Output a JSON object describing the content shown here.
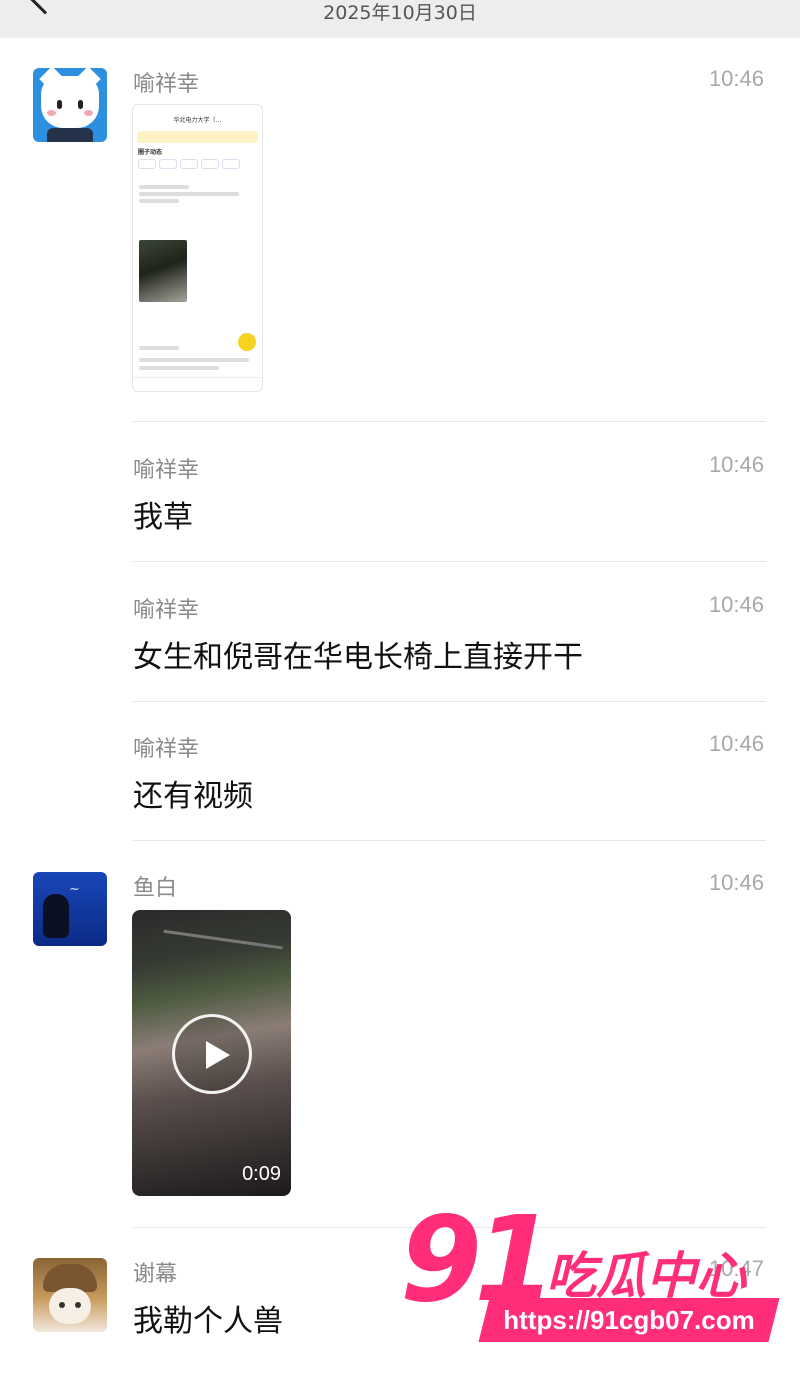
{
  "header": {
    "date": "2025年10月30日"
  },
  "messages": [
    {
      "sender": "喻祥幸",
      "time": "10:46",
      "type": "image"
    },
    {
      "sender": "喻祥幸",
      "time": "10:46",
      "text": "我草"
    },
    {
      "sender": "喻祥幸",
      "time": "10:46",
      "text": "女生和倪哥在华电长椅上直接开干"
    },
    {
      "sender": "喻祥幸",
      "time": "10:46",
      "text": "还有视频"
    },
    {
      "sender": "鱼白",
      "time": "10:46",
      "type": "video",
      "duration": "0:09"
    },
    {
      "sender": "谢幕",
      "time": "10:47",
      "text": "我勒个人兽"
    }
  ],
  "screenshot_preview": {
    "header_title": "华北电力大学（…",
    "tab_label": "圈子动态"
  },
  "watermark": {
    "logo_number": "91",
    "logo_text": "吃瓜中心",
    "url": "https://91cgb07.com",
    "color": "#ff2d7a"
  },
  "icons": {
    "back": "back-chevron-icon",
    "play": "play-icon"
  }
}
